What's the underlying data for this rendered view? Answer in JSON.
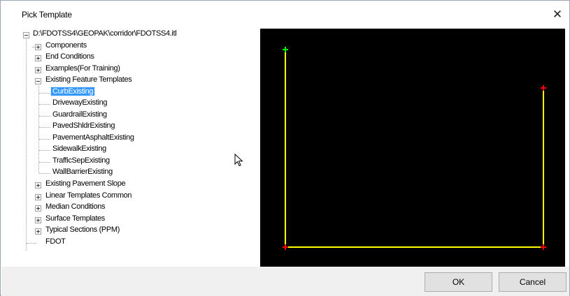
{
  "dialog": {
    "title": "Pick Template",
    "close_glyph": "✕"
  },
  "tree": {
    "root": "D:\\FDOTSS4\\GEOPAK\\corridor\\FDOTSS4.itl",
    "folders_before": [
      "Components",
      "End Conditions",
      "Examples(For Training)"
    ],
    "expanded_folder": "Existing Feature Templates",
    "children": [
      "CurbExisting",
      "DrivewayExisting",
      "GuardrailExisting",
      "PavedShldrExisting",
      "PavementAsphaltExisting",
      "SidewalkExisting",
      "TrafficSepExisting",
      "WallBarrierExisting"
    ],
    "selected_child": "CurbExisting",
    "folders_after": [
      "Existing Pavement Slope",
      "Linear Templates Common",
      "Median Conditions",
      "Surface Templates",
      "Typical Sections (PPM)"
    ],
    "leaf_last": "FDOT"
  },
  "preview": {
    "background": "#000000",
    "line_color": "#ffff00",
    "end_point_color": "#ff0000",
    "start_point_color": "#00ff00"
  },
  "buttons": {
    "ok": "OK",
    "cancel": "Cancel"
  }
}
